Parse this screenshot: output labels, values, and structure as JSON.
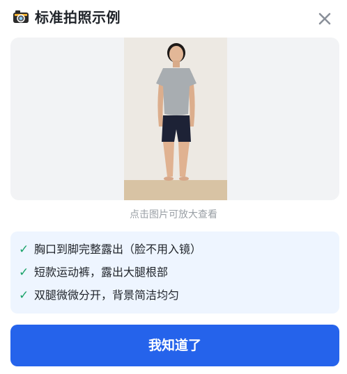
{
  "header": {
    "title": "标准拍照示例",
    "icon": "camera-icon",
    "close_icon": "close-icon"
  },
  "example_photo": {
    "description_icon": "person-photo",
    "hint": "点击图片可放大查看"
  },
  "checklist": [
    {
      "icon": "check-icon",
      "text": "胸口到脚完整露出（脸不用入镜）"
    },
    {
      "icon": "check-icon",
      "text": "短款运动裤，露出大腿根部"
    },
    {
      "icon": "check-icon",
      "text": "双腿微微分开，背景简洁均匀"
    }
  ],
  "confirm_button": {
    "label": "我知道了"
  },
  "colors": {
    "primary": "#2563eb",
    "check": "#1aa36a",
    "panel_bg": "#eef5ff",
    "photo_bg": "#f2f3f5"
  }
}
